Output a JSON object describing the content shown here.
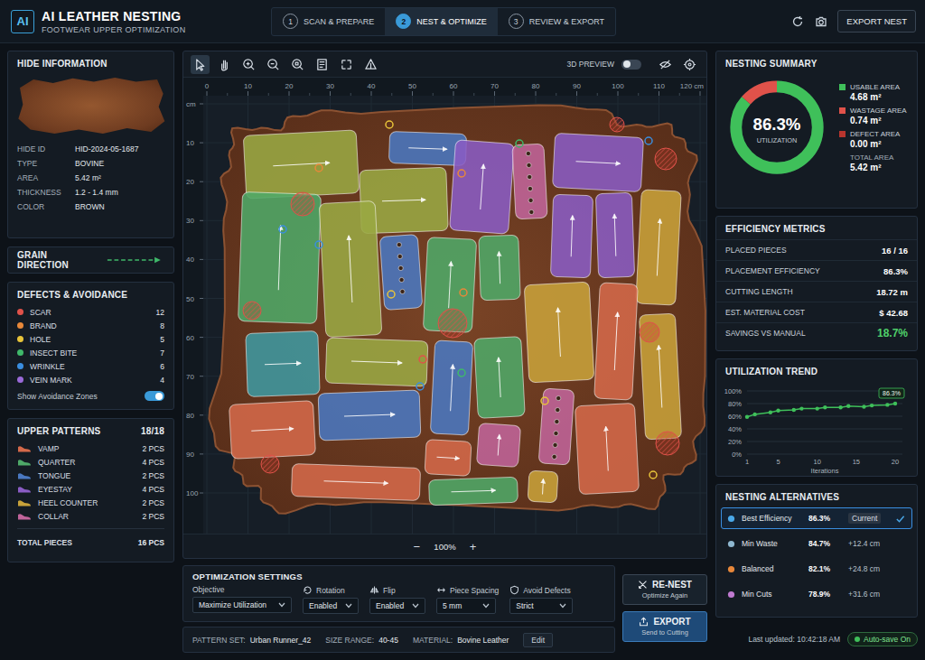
{
  "app": {
    "logo": "AI",
    "title": "AI LEATHER NESTING",
    "subtitle": "FOOTWEAR UPPER OPTIMIZATION"
  },
  "steps": [
    {
      "number": "1",
      "label": "SCAN & PREPARE",
      "selected": false
    },
    {
      "number": "2",
      "label": "NEST & OPTIMIZE",
      "selected": true
    },
    {
      "number": "3",
      "label": "REVIEW & EXPORT",
      "selected": false
    }
  ],
  "export_nest_button": "EXPORT NEST",
  "hide": {
    "title": "HIDE INFORMATION",
    "fields": [
      {
        "label": "HIDE ID",
        "value": "HID-2024-05-1687"
      },
      {
        "label": "TYPE",
        "value": "BOVINE"
      },
      {
        "label": "AREA",
        "value": "5.42 m²"
      },
      {
        "label": "THICKNESS",
        "value": "1.2 - 1.4 mm"
      },
      {
        "label": "COLOR",
        "value": "BROWN"
      }
    ]
  },
  "grain": {
    "title": "GRAIN DIRECTION"
  },
  "defects": {
    "title": "DEFECTS & AVOIDANCE",
    "items": [
      {
        "name": "SCAR",
        "count": "12",
        "color": "#e0524a"
      },
      {
        "name": "BRAND",
        "count": "8",
        "color": "#e8883a"
      },
      {
        "name": "HOLE",
        "count": "5",
        "color": "#e8c43a"
      },
      {
        "name": "INSECT BITE",
        "count": "7",
        "color": "#3fb86a"
      },
      {
        "name": "WRINKLE",
        "count": "6",
        "color": "#3a8ee0"
      },
      {
        "name": "VEIN MARK",
        "count": "4",
        "color": "#9a6ad8"
      }
    ],
    "toggle": {
      "label": "Show Avoidance Zones",
      "on": true
    }
  },
  "patterns": {
    "title": "UPPER PATTERNS",
    "count": "18/18",
    "items": [
      {
        "name": "VAMP",
        "count": "2 PCS",
        "color": "#d4694a"
      },
      {
        "name": "QUARTER",
        "count": "4 PCS",
        "color": "#4ea868"
      },
      {
        "name": "TONGUE",
        "count": "2 PCS",
        "color": "#4a78c0"
      },
      {
        "name": "EYESTAY",
        "count": "4 PCS",
        "color": "#8a5cc4"
      },
      {
        "name": "HEEL COUNTER",
        "count": "2 PCS",
        "color": "#c8a23a"
      },
      {
        "name": "COLLAR",
        "count": "2 PCS",
        "color": "#c0649a"
      }
    ],
    "total_label": "TOTAL PIECES",
    "total": "16 PCS"
  },
  "toolbar": {
    "tools": [
      {
        "selected": true
      },
      {
        "selected": false
      },
      {
        "selected": false
      },
      {
        "selected": false
      },
      {
        "selected": false
      },
      {
        "selected": false
      },
      {
        "selected": false
      },
      {
        "selected": false
      }
    ],
    "preview": {
      "label": "3D PREVIEW",
      "on": false
    }
  },
  "canvas": {
    "ruler_x": [
      "0",
      "10",
      "20",
      "30",
      "40",
      "50",
      "60",
      "70",
      "80",
      "90",
      "100",
      "110",
      "120 cm"
    ],
    "ruler_y": [
      "cm",
      "10",
      "20",
      "30",
      "40",
      "50",
      "60",
      "70",
      "80",
      "90",
      "100"
    ],
    "pieces": [
      {
        "color": "#9aa843"
      },
      {
        "color": "#4a78c0"
      },
      {
        "color": "#8a5cc4"
      },
      {
        "color": "#c0649a"
      },
      {
        "color": "#8a5cc4"
      },
      {
        "color": "#9aa843"
      },
      {
        "color": "#4ea868"
      },
      {
        "color": "#9aa843"
      },
      {
        "color": "#8a5cc4"
      },
      {
        "color": "#8a5cc4"
      },
      {
        "color": "#c8a23a"
      },
      {
        "color": "#4a78c0"
      },
      {
        "color": "#4ea868"
      },
      {
        "color": "#4ea868"
      },
      {
        "color": "#c8a23a"
      },
      {
        "color": "#d4694a"
      },
      {
        "color": "#3f98a0"
      },
      {
        "color": "#9aa843"
      },
      {
        "color": "#4ea868"
      },
      {
        "color": "#4a78c0"
      },
      {
        "color": "#c0649a"
      },
      {
        "color": "#c8a23a"
      },
      {
        "color": "#4a78c0"
      },
      {
        "color": "#d4694a"
      },
      {
        "color": "#d4694a"
      },
      {
        "color": "#d4694a"
      },
      {
        "color": "#4ea868"
      },
      {
        "color": "#c8a23a"
      },
      {
        "color": "#d4694a"
      },
      {
        "color": "#c0649a"
      }
    ]
  },
  "zoom": {
    "minus": "−",
    "value": "100%",
    "plus": "+"
  },
  "settings": {
    "title": "OPTIMIZATION SETTINGS",
    "fields": [
      {
        "label": "Objective",
        "value": "Maximize Utilization"
      },
      {
        "label": "Rotation",
        "value": "Enabled"
      },
      {
        "label": "Flip",
        "value": "Enabled"
      },
      {
        "label": "Piece Spacing",
        "value": "5 mm"
      },
      {
        "label": "Avoid Defects",
        "value": "Strict"
      }
    ],
    "renest": {
      "label": "RE-NEST",
      "sub": "Optimize Again"
    },
    "export": {
      "label": "EXPORT",
      "sub": "Send to Cutting"
    }
  },
  "footer": {
    "items": [
      {
        "label": "PATTERN SET:",
        "value": "Urban Runner_42"
      },
      {
        "label": "SIZE RANGE:",
        "value": "40-45"
      },
      {
        "label": "MATERIAL:",
        "value": "Bovine Leather"
      }
    ],
    "edit": "Edit",
    "last_updated": "Last updated: 10:42:18 AM",
    "autosave": "Auto-save On"
  },
  "summary": {
    "title": "NESTING SUMMARY",
    "value": "86.3%",
    "caption": "UTILIZATION",
    "segments": [
      {
        "label": "USABLE AREA",
        "value": "4.68 m²",
        "level": 0.863,
        "color": "#3fc05a"
      },
      {
        "label": "WASTAGE AREA",
        "value": "0.74 m²",
        "level": 0.137,
        "color": "#e0524a"
      },
      {
        "label": "DEFECT AREA",
        "value": "0.00 m²",
        "level": 0,
        "color": "#b8352e"
      }
    ],
    "total_label": "TOTAL AREA",
    "total": "5.42 m²"
  },
  "metrics": {
    "title": "EFFICIENCY METRICS",
    "rows": [
      {
        "label": "PLACED PIECES",
        "value": "16 / 16",
        "positive": false
      },
      {
        "label": "PLACEMENT EFFICIENCY",
        "value": "86.3%",
        "positive": false
      },
      {
        "label": "CUTTING LENGTH",
        "value": "18.72 m",
        "positive": false
      },
      {
        "label": "EST. MATERIAL COST",
        "value": "$ 42.68",
        "positive": false
      },
      {
        "label": "SAVINGS VS MANUAL",
        "value": "18.7%",
        "positive": true
      }
    ]
  },
  "trend": {
    "title": "UTILIZATION TREND",
    "y_ticks": [
      "100%",
      "80%",
      "60%",
      "40%",
      "20%",
      "0%"
    ],
    "x_ticks": [
      "1",
      "5",
      "10",
      "15",
      "20"
    ],
    "x_label": "Iterations",
    "badge": "86.3%",
    "iterations": [
      1,
      2,
      4,
      5,
      7,
      8,
      10,
      11,
      13,
      14,
      16,
      17,
      19,
      20
    ],
    "values": [
      59,
      63,
      66,
      69,
      70,
      72,
      72,
      74,
      74,
      76,
      75,
      77,
      78,
      80
    ]
  },
  "alternatives": {
    "title": "NESTING ALTERNATIVES",
    "items": [
      {
        "name": "Best Efficiency",
        "value": "86.3%",
        "tag": "Current",
        "selected": true
      },
      {
        "name": "Min Waste",
        "value": "84.7%",
        "tag": "+12.4 cm",
        "selected": false
      },
      {
        "name": "Balanced",
        "value": "82.1%",
        "tag": "+24.8 cm",
        "selected": false
      },
      {
        "name": "Min Cuts",
        "value": "78.9%",
        "tag": "+31.6 cm",
        "selected": false
      }
    ]
  }
}
